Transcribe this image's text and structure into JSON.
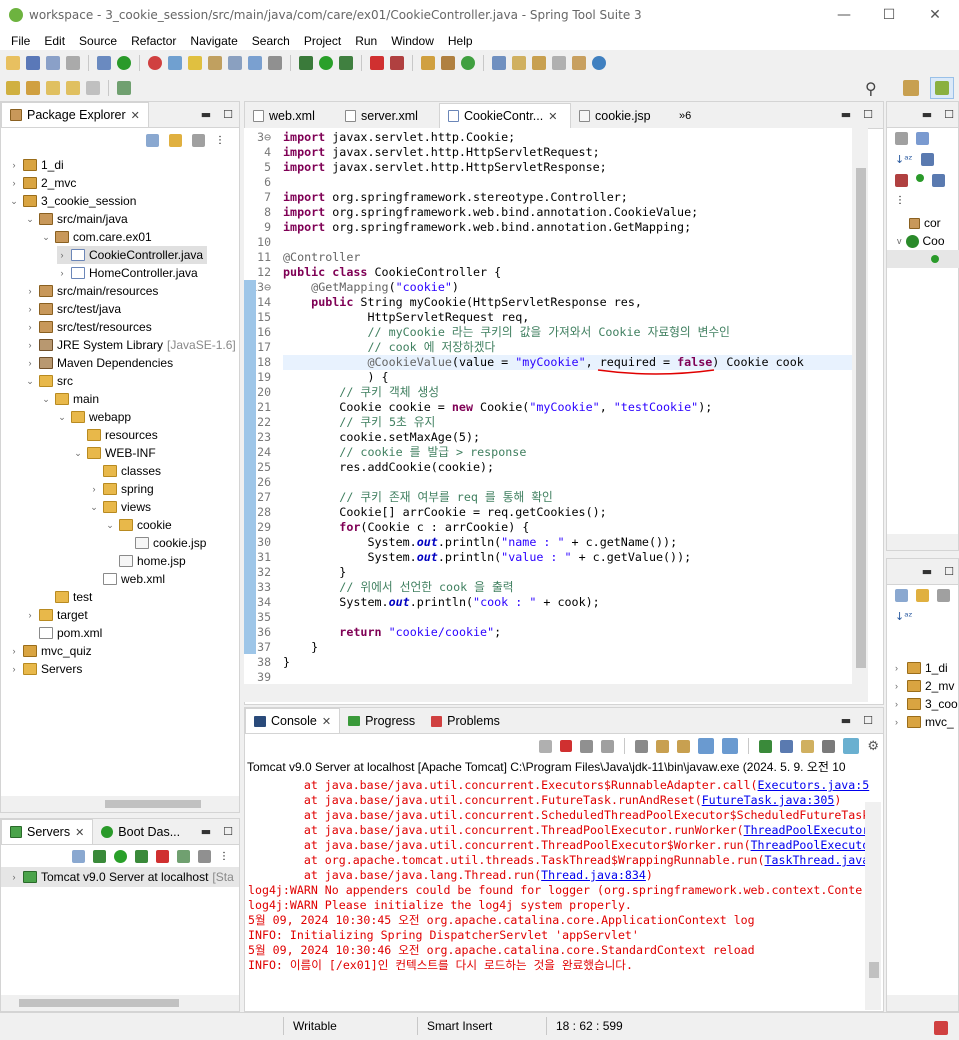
{
  "window": {
    "title": "workspace - 3_cookie_session/src/main/java/com/care/ex01/CookieController.java - Spring Tool Suite 3"
  },
  "menu": [
    "File",
    "Edit",
    "Source",
    "Refactor",
    "Navigate",
    "Search",
    "Project",
    "Run",
    "Window",
    "Help"
  ],
  "package_explorer": {
    "title": "Package Explorer",
    "tree": [
      {
        "indent": 0,
        "tw": ">",
        "icon": "proj",
        "label": "1_di"
      },
      {
        "indent": 0,
        "tw": ">",
        "icon": "proj",
        "label": "2_mvc"
      },
      {
        "indent": 0,
        "tw": "v",
        "icon": "proj",
        "label": "3_cookie_session"
      },
      {
        "indent": 1,
        "tw": "v",
        "icon": "pkg",
        "label": "src/main/java"
      },
      {
        "indent": 2,
        "tw": "v",
        "icon": "pkg",
        "label": "com.care.ex01"
      },
      {
        "indent": 3,
        "tw": ">",
        "icon": "java",
        "label": "CookieController.java",
        "selected": true
      },
      {
        "indent": 3,
        "tw": ">",
        "icon": "java",
        "label": "HomeController.java"
      },
      {
        "indent": 1,
        "tw": ">",
        "icon": "pkg",
        "label": "src/main/resources"
      },
      {
        "indent": 1,
        "tw": ">",
        "icon": "pkg",
        "label": "src/test/java"
      },
      {
        "indent": 1,
        "tw": ">",
        "icon": "pkg",
        "label": "src/test/resources"
      },
      {
        "indent": 1,
        "tw": ">",
        "icon": "lib",
        "label": "JRE System Library",
        "deco": "[JavaSE-1.6]"
      },
      {
        "indent": 1,
        "tw": ">",
        "icon": "lib",
        "label": "Maven Dependencies"
      },
      {
        "indent": 1,
        "tw": "v",
        "icon": "folder",
        "label": "src"
      },
      {
        "indent": 2,
        "tw": "v",
        "icon": "folder",
        "label": "main"
      },
      {
        "indent": 3,
        "tw": "v",
        "icon": "folder",
        "label": "webapp"
      },
      {
        "indent": 4,
        "tw": "",
        "icon": "folder",
        "label": "resources"
      },
      {
        "indent": 4,
        "tw": "v",
        "icon": "folder",
        "label": "WEB-INF"
      },
      {
        "indent": 5,
        "tw": "",
        "icon": "folder",
        "label": "classes"
      },
      {
        "indent": 5,
        "tw": ">",
        "icon": "folder",
        "label": "spring"
      },
      {
        "indent": 5,
        "tw": "v",
        "icon": "folder",
        "label": "views"
      },
      {
        "indent": 6,
        "tw": "v",
        "icon": "folder",
        "label": "cookie"
      },
      {
        "indent": 7,
        "tw": "",
        "icon": "jsp",
        "label": "cookie.jsp"
      },
      {
        "indent": 6,
        "tw": "",
        "icon": "jsp",
        "label": "home.jsp"
      },
      {
        "indent": 5,
        "tw": "",
        "icon": "xml",
        "label": "web.xml"
      },
      {
        "indent": 2,
        "tw": "",
        "icon": "folder",
        "label": "test"
      },
      {
        "indent": 1,
        "tw": ">",
        "icon": "folder",
        "label": "target"
      },
      {
        "indent": 1,
        "tw": "",
        "icon": "xml",
        "label": "pom.xml"
      },
      {
        "indent": 0,
        "tw": ">",
        "icon": "proj",
        "label": "mvc_quiz"
      },
      {
        "indent": 0,
        "tw": ">",
        "icon": "folder",
        "label": "Servers"
      }
    ]
  },
  "editor_tabs": [
    {
      "label": "web.xml",
      "icon": "xml"
    },
    {
      "label": "server.xml",
      "icon": "xml"
    },
    {
      "label": "CookieContr...",
      "icon": "java",
      "active": true
    },
    {
      "label": "cookie.jsp",
      "icon": "jsp"
    },
    {
      "label": "»6",
      "icon": ""
    }
  ],
  "code": [
    {
      "n": "3⊖",
      "html": "<span class='kw'>import</span> javax.servlet.http.Cookie;"
    },
    {
      "n": "4",
      "html": "<span class='kw'>import</span> javax.servlet.http.HttpServletRequest;"
    },
    {
      "n": "5",
      "html": "<span class='kw'>import</span> javax.servlet.http.HttpServletResponse;"
    },
    {
      "n": "6",
      "html": ""
    },
    {
      "n": "7",
      "html": "<span class='kw'>import</span> org.springframework.stereotype.Controller;"
    },
    {
      "n": "8",
      "html": "<span class='kw'>import</span> org.springframework.web.bind.annotation.CookieValue;"
    },
    {
      "n": "9",
      "html": "<span class='kw'>import</span> org.springframework.web.bind.annotation.GetMapping;"
    },
    {
      "n": "10",
      "html": ""
    },
    {
      "n": "11",
      "html": "<span class='an'>@Controller</span>"
    },
    {
      "n": "12",
      "html": "<span class='kw'>public</span> <span class='kw'>class</span> CookieController {"
    },
    {
      "n": "13⊖",
      "html": "    <span class='an'>@GetMapping</span>(<span class='str'>\"cookie\"</span>)"
    },
    {
      "n": "14",
      "html": "    <span class='kw'>public</span> String myCookie(HttpServletResponse res,"
    },
    {
      "n": "15",
      "html": "            HttpServletRequest req,"
    },
    {
      "n": "16",
      "html": "            <span class='cm'>// myCookie 라는 쿠키의 값을 가져와서 Cookie 자료형의 변수인</span>"
    },
    {
      "n": "17",
      "html": "            <span class='cm'>// cook 에 저장하겠다</span>"
    },
    {
      "n": "18",
      "html": "            <span class='an'>@CookieValue</span>(value = <span class='str'>\"myCookie\"</span>, required = <span class='kw'>false</span>) Cookie cook",
      "hl": true
    },
    {
      "n": "19",
      "html": "            ) {"
    },
    {
      "n": "20",
      "html": "        <span class='cm'>// 쿠키 객체 생성</span>"
    },
    {
      "n": "21",
      "html": "        Cookie cookie = <span class='kw'>new</span> Cookie(<span class='str'>\"myCookie\"</span>, <span class='str'>\"testCookie\"</span>);"
    },
    {
      "n": "22",
      "html": "        <span class='cm'>// 쿠키 5초 유지</span>"
    },
    {
      "n": "23",
      "html": "        cookie.setMaxAge(5);"
    },
    {
      "n": "24",
      "html": "        <span class='cm'>// cookie 를 발급 > response</span>"
    },
    {
      "n": "25",
      "html": "        res.addCookie(cookie);"
    },
    {
      "n": "26",
      "html": ""
    },
    {
      "n": "27",
      "html": "        <span class='cm'>// 쿠키 존재 여부를 req 를 통해 확인</span>"
    },
    {
      "n": "28",
      "html": "        Cookie[] arrCookie = req.getCookies();"
    },
    {
      "n": "29",
      "html": "        <span class='kw'>for</span>(Cookie c : arrCookie) {"
    },
    {
      "n": "30",
      "html": "            System.<span class='it'>out</span>.println(<span class='str'>\"name : \"</span> + c.getName());"
    },
    {
      "n": "31",
      "html": "            System.<span class='it'>out</span>.println(<span class='str'>\"value : \"</span> + c.getValue());"
    },
    {
      "n": "32",
      "html": "        }"
    },
    {
      "n": "33",
      "html": "        <span class='cm'>// 위에서 선언한 cook 을 출력</span>"
    },
    {
      "n": "34",
      "html": "        System.<span class='it'>out</span>.println(<span class='str'>\"cook : \"</span> + cook);"
    },
    {
      "n": "35",
      "html": ""
    },
    {
      "n": "36",
      "html": "        <span class='kw'>return</span> <span class='str'>\"cookie/cookie\"</span>;"
    },
    {
      "n": "37",
      "html": "    }"
    },
    {
      "n": "38",
      "html": "}"
    },
    {
      "n": "39",
      "html": ""
    }
  ],
  "console": {
    "tabs": [
      "Console",
      "Progress",
      "Problems"
    ],
    "header": "Tomcat v9.0 Server at localhost [Apache Tomcat] C:\\Program Files\\Java\\jdk-11\\bin\\javaw.exe  (2024. 5. 9. 오전 10",
    "lines": [
      {
        "pre": "        at java.base/java.util.concurrent.Executors$RunnableAdapter.call(",
        "link": "Executors.java:5"
      },
      {
        "pre": "        at java.base/java.util.concurrent.FutureTask.runAndReset(",
        "link": "FutureTask.java:305",
        "post": ")"
      },
      {
        "pre": "        at java.base/java.util.concurrent.ScheduledThreadPoolExecutor$ScheduledFutureTask"
      },
      {
        "pre": "        at java.base/java.util.concurrent.ThreadPoolExecutor.runWorker(",
        "link": "ThreadPoolExecutor"
      },
      {
        "pre": "        at java.base/java.util.concurrent.ThreadPoolExecutor$Worker.run(",
        "link": "ThreadPoolExecuto"
      },
      {
        "pre": "        at org.apache.tomcat.util.threads.TaskThread$WrappingRunnable.run(",
        "link": "TaskThread.java"
      },
      {
        "pre": "        at java.base/java.lang.Thread.run(",
        "link": "Thread.java:834",
        "post": ")"
      },
      {
        "pre": "log4j:WARN No appenders could be found for logger (org.springframework.web.context.Conte"
      },
      {
        "pre": "log4j:WARN Please initialize the log4j system properly."
      },
      {
        "pre": "5월 09, 2024 10:30:45 오전 org.apache.catalina.core.ApplicationContext log"
      },
      {
        "pre": "INFO: Initializing Spring DispatcherServlet 'appServlet'"
      },
      {
        "pre": "5월 09, 2024 10:30:46 오전 org.apache.catalina.core.StandardContext reload"
      },
      {
        "pre": "INFO: 이름이 [/ex01]인 컨텍스트를 다시 로드하는 것을 완료했습니다."
      }
    ]
  },
  "servers": {
    "tabs": [
      "Servers",
      "Boot Das..."
    ],
    "item": "Tomcat v9.0 Server at localhost",
    "item_deco": "[Sta"
  },
  "right_panel": {
    "outline_items": [
      "cor",
      "Coo"
    ],
    "nav_items": [
      "1_di",
      "2_mv",
      "3_coo",
      "mvc_"
    ]
  },
  "status": {
    "mode": "Writable",
    "insert": "Smart Insert",
    "position": "18 : 62 : 599"
  }
}
